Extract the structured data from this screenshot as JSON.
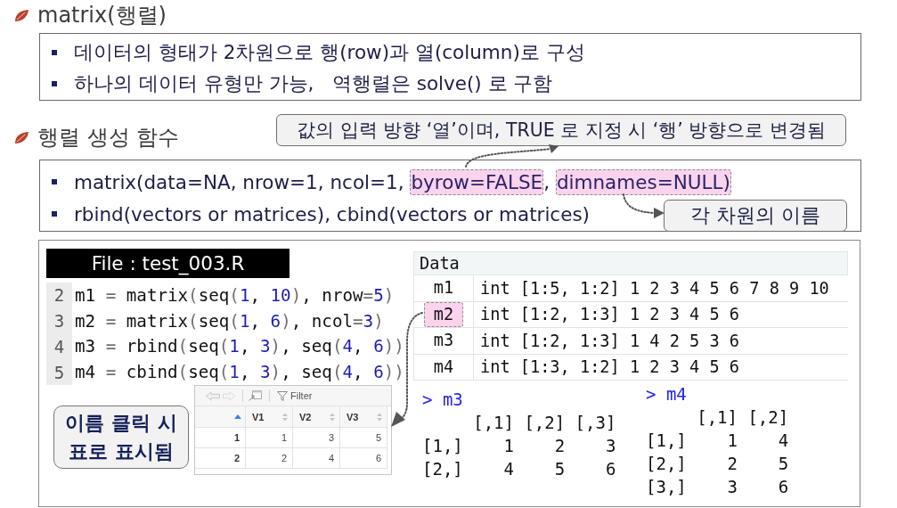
{
  "sections": [
    {
      "heading": "matrix(행렬)",
      "bullets": [
        {
          "segments": [
            {
              "text": "데이터의 형태가 2차원으로 행(row)과 열(column)로 구성",
              "highlighted": false
            }
          ]
        },
        {
          "segments": [
            {
              "text": "하나의 데이터 유형만 가능,   역행렬은 solve() 로 구함",
              "highlighted": false
            }
          ]
        }
      ]
    },
    {
      "heading": "행렬 생성 함수",
      "notes": [
        "값의 입력 방향 ‘열’이며, TRUE 로 지정 시 ‘행’ 방향으로 변경됨",
        "각 차원의 이름"
      ],
      "bullets": [
        {
          "segments": [
            {
              "text": "matrix(data=NA, nrow=1, ncol=1, ",
              "highlighted": false
            },
            {
              "text": "byrow=FALSE",
              "highlighted": true
            },
            {
              "text": ", ",
              "highlighted": false
            },
            {
              "text": "dimnames=NULL)",
              "highlighted": true
            }
          ]
        },
        {
          "segments": [
            {
              "text": "rbind(vectors or matrices), cbind(vectors or matrices)",
              "highlighted": false
            }
          ]
        }
      ]
    }
  ],
  "example": {
    "script": {
      "title": "File : test_003.R",
      "lines": [
        {
          "number": "2",
          "code": "m1 = matrix(seq(1, 10), nrow=5)"
        },
        {
          "number": "3",
          "code": "m2 = matrix(seq(1, 6), ncol=3)"
        },
        {
          "number": "4",
          "code": "m3 = rbind(seq(1, 3), seq(4, 6))"
        },
        {
          "number": "5",
          "code": "m4 = cbind(seq(1, 3), seq(4, 6))"
        }
      ]
    },
    "note": "이름 클릭 시 표로 표시됨",
    "viewer": {
      "filter_label": "Filter",
      "columns": [
        "V1",
        "V2",
        "V3"
      ],
      "rows": [
        {
          "label": "1",
          "cells": [
            "1",
            "3",
            "5"
          ]
        },
        {
          "label": "2",
          "cells": [
            "2",
            "4",
            "6"
          ]
        }
      ]
    },
    "environment": {
      "header": "Data",
      "rows": [
        {
          "name": "m1",
          "value": "int [1:5, 1:2] 1 2 3 4 5 6 7 8 9 10",
          "highlighted": false
        },
        {
          "name": "m2",
          "value": "int [1:2, 1:3] 1 2 3 4 5 6",
          "highlighted": true
        },
        {
          "name": "m3",
          "value": "int [1:2, 1:3] 1 4 2 5 3 6",
          "highlighted": false
        },
        {
          "name": "m4",
          "value": "int [1:3, 1:2] 1 2 3 4 5 6",
          "highlighted": false
        }
      ]
    },
    "console": [
      {
        "command": "> m3",
        "output": [
          "     [,1] [,2] [,3]",
          "[1,]    1    2    3",
          "[2,]    4    5    6"
        ]
      },
      {
        "command": "> m4",
        "output": [
          "     [,1] [,2]",
          "[1,]    1    4",
          "[2,]    2    5",
          "[3,]    3    6"
        ]
      }
    ]
  }
}
